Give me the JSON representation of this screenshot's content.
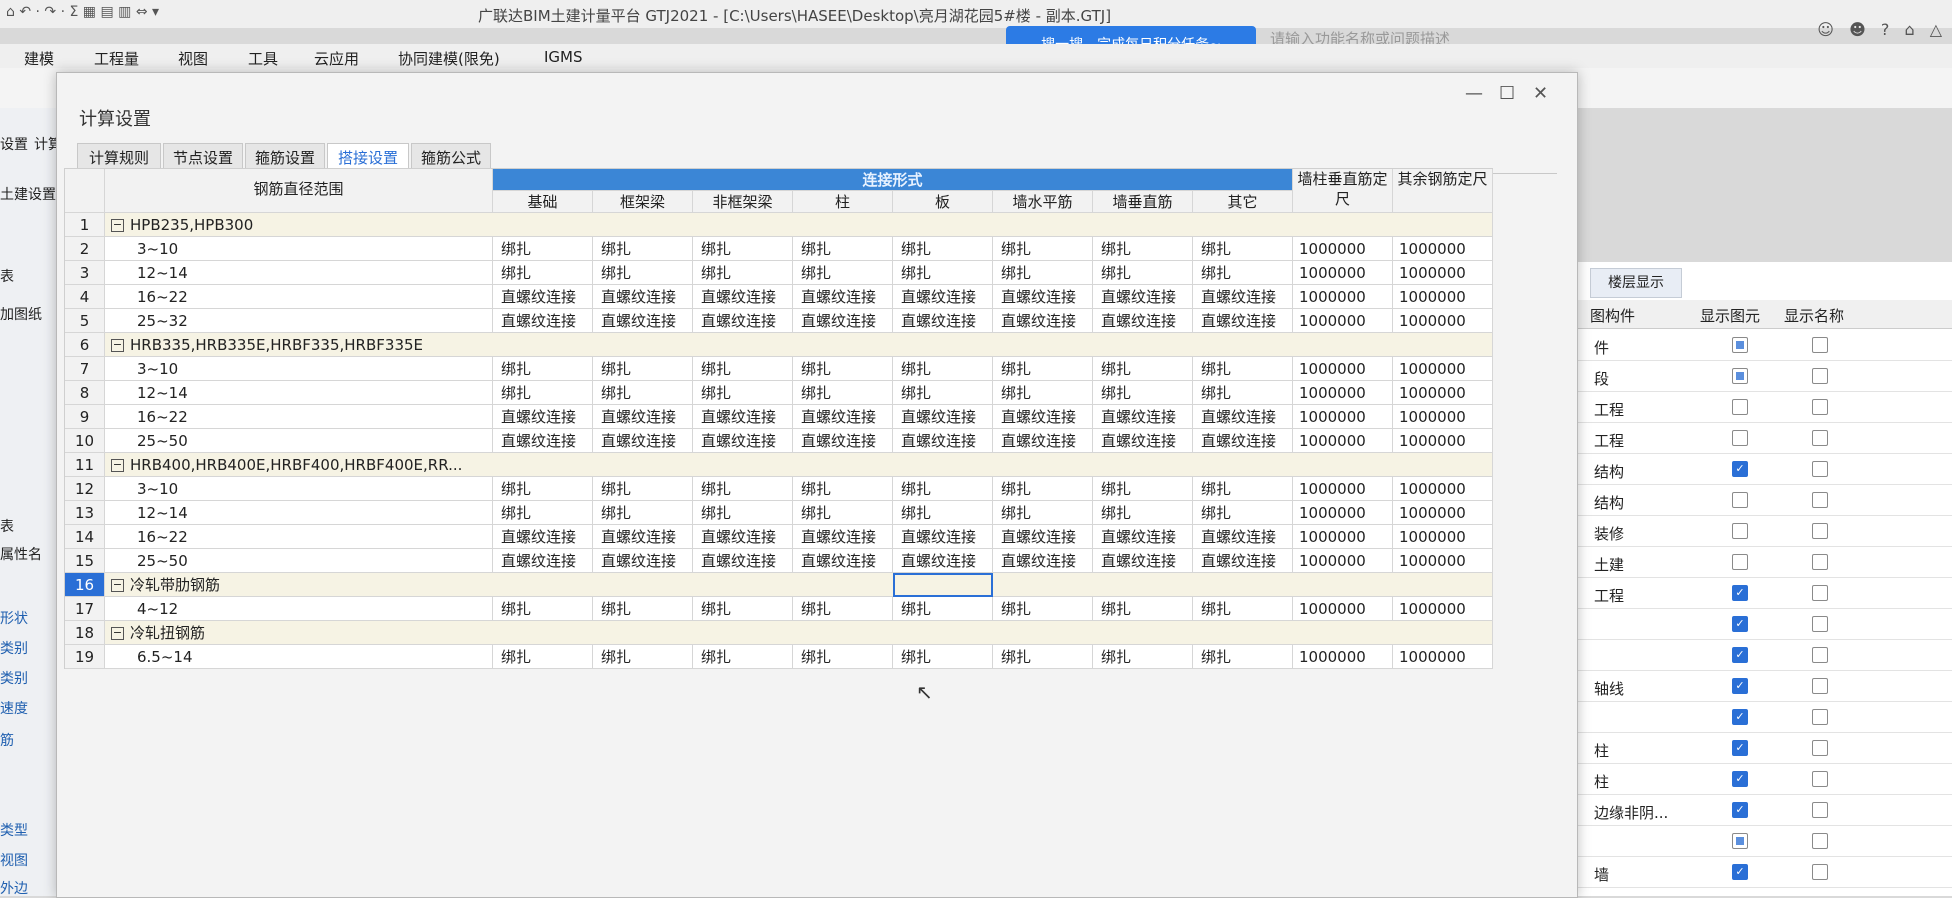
{
  "app": {
    "title": "广联达BIM土建计量平台 GTJ2021 - [C:\\Users\\HASEE\\Desktop\\亮月湖花园5#楼 - 副本.GTJ]",
    "tip": "搜一搜，完成每日积分任务~",
    "search_placeholder": "请输入功能名称或问题描述",
    "quick_access": "⌂ ↶ · ↷ · Σ ▦ ▤ ▥ ⇔ ▾",
    "window_controls": [
      "☺",
      "☻",
      "?",
      "⌂",
      "△"
    ]
  },
  "menu": [
    "建模",
    "工程量",
    "视图",
    "工具",
    "云应用",
    "协同建模(限免)",
    "IGMS"
  ],
  "left_strip": [
    "设置",
    "计算",
    "土建设置",
    "表",
    "加图纸",
    "表",
    "属性名",
    "形状",
    "类别",
    "类别",
    "速度",
    "筋",
    "类型",
    "视图",
    "外边"
  ],
  "right_panel": {
    "tab": "楼层显示",
    "headers": [
      "图构件",
      "显示图元",
      "显示名称"
    ],
    "rows": [
      {
        "name": "件",
        "shown": "partial",
        "name_shown": "off"
      },
      {
        "name": "段",
        "shown": "partial",
        "name_shown": "off"
      },
      {
        "name": "工程",
        "shown": "off",
        "name_shown": "off"
      },
      {
        "name": "工程",
        "shown": "off",
        "name_shown": "off"
      },
      {
        "name": "结构",
        "shown": "on",
        "name_shown": "off"
      },
      {
        "name": "结构",
        "shown": "off",
        "name_shown": "off"
      },
      {
        "name": "装修",
        "shown": "off",
        "name_shown": "off"
      },
      {
        "name": "土建",
        "shown": "off",
        "name_shown": "off"
      },
      {
        "name": "工程",
        "shown": "on",
        "name_shown": "off"
      },
      {
        "name": "",
        "shown": "on",
        "name_shown": "off"
      },
      {
        "name": "",
        "shown": "on",
        "name_shown": "off"
      },
      {
        "name": "轴线",
        "shown": "on",
        "name_shown": "off"
      },
      {
        "name": "",
        "shown": "on",
        "name_shown": "off"
      },
      {
        "name": "柱",
        "shown": "on",
        "name_shown": "off"
      },
      {
        "name": "柱",
        "shown": "on",
        "name_shown": "off"
      },
      {
        "name": "边缘非阴...",
        "shown": "on",
        "name_shown": "off"
      },
      {
        "name": "",
        "shown": "partial",
        "name_shown": "off"
      },
      {
        "name": "墙",
        "shown": "on",
        "name_shown": "off"
      }
    ]
  },
  "dialog": {
    "title": "计算设置",
    "controls": [
      "—",
      "☐",
      "✕"
    ],
    "tabs": [
      "计算规则",
      "节点设置",
      "箍筋设置",
      "搭接设置",
      "箍筋公式"
    ],
    "active_tab": 3,
    "grid": {
      "col_range": "钢筋直径范围",
      "group_header": "连接形式",
      "sub_headers": [
        "基础",
        "框架梁",
        "非框架梁",
        "柱",
        "板",
        "墙水平筋",
        "墙垂直筋",
        "其它"
      ],
      "col_wall": "墙柱垂直筋定尺",
      "col_other": "其余钢筋定尺",
      "rows": [
        {
          "n": "1",
          "label": "HPB235,HPB300",
          "group": true
        },
        {
          "n": "2",
          "label": "3~10",
          "vals": [
            "绑扎",
            "绑扎",
            "绑扎",
            "绑扎",
            "绑扎",
            "绑扎",
            "绑扎",
            "绑扎"
          ],
          "wall": "1000000",
          "other": "1000000"
        },
        {
          "n": "3",
          "label": "12~14",
          "vals": [
            "绑扎",
            "绑扎",
            "绑扎",
            "绑扎",
            "绑扎",
            "绑扎",
            "绑扎",
            "绑扎"
          ],
          "wall": "1000000",
          "other": "1000000"
        },
        {
          "n": "4",
          "label": "16~22",
          "vals": [
            "直螺纹连接",
            "直螺纹连接",
            "直螺纹连接",
            "直螺纹连接",
            "直螺纹连接",
            "直螺纹连接",
            "直螺纹连接",
            "直螺纹连接"
          ],
          "wall": "1000000",
          "other": "1000000"
        },
        {
          "n": "5",
          "label": "25~32",
          "vals": [
            "直螺纹连接",
            "直螺纹连接",
            "直螺纹连接",
            "直螺纹连接",
            "直螺纹连接",
            "直螺纹连接",
            "直螺纹连接",
            "直螺纹连接"
          ],
          "wall": "1000000",
          "other": "1000000"
        },
        {
          "n": "6",
          "label": "HRB335,HRB335E,HRBF335,HRBF335E",
          "group": true
        },
        {
          "n": "7",
          "label": "3~10",
          "vals": [
            "绑扎",
            "绑扎",
            "绑扎",
            "绑扎",
            "绑扎",
            "绑扎",
            "绑扎",
            "绑扎"
          ],
          "wall": "1000000",
          "other": "1000000"
        },
        {
          "n": "8",
          "label": "12~14",
          "vals": [
            "绑扎",
            "绑扎",
            "绑扎",
            "绑扎",
            "绑扎",
            "绑扎",
            "绑扎",
            "绑扎"
          ],
          "wall": "1000000",
          "other": "1000000"
        },
        {
          "n": "9",
          "label": "16~22",
          "vals": [
            "直螺纹连接",
            "直螺纹连接",
            "直螺纹连接",
            "直螺纹连接",
            "直螺纹连接",
            "直螺纹连接",
            "直螺纹连接",
            "直螺纹连接"
          ],
          "wall": "1000000",
          "other": "1000000"
        },
        {
          "n": "10",
          "label": "25~50",
          "vals": [
            "直螺纹连接",
            "直螺纹连接",
            "直螺纹连接",
            "直螺纹连接",
            "直螺纹连接",
            "直螺纹连接",
            "直螺纹连接",
            "直螺纹连接"
          ],
          "wall": "1000000",
          "other": "1000000"
        },
        {
          "n": "11",
          "label": "HRB400,HRB400E,HRBF400,HRBF400E,RR...",
          "group": true
        },
        {
          "n": "12",
          "label": "3~10",
          "vals": [
            "绑扎",
            "绑扎",
            "绑扎",
            "绑扎",
            "绑扎",
            "绑扎",
            "绑扎",
            "绑扎"
          ],
          "wall": "1000000",
          "other": "1000000"
        },
        {
          "n": "13",
          "label": "12~14",
          "vals": [
            "绑扎",
            "绑扎",
            "绑扎",
            "绑扎",
            "绑扎",
            "绑扎",
            "绑扎",
            "绑扎"
          ],
          "wall": "1000000",
          "other": "1000000"
        },
        {
          "n": "14",
          "label": "16~22",
          "vals": [
            "直螺纹连接",
            "直螺纹连接",
            "直螺纹连接",
            "直螺纹连接",
            "直螺纹连接",
            "直螺纹连接",
            "直螺纹连接",
            "直螺纹连接"
          ],
          "wall": "1000000",
          "other": "1000000"
        },
        {
          "n": "15",
          "label": "25~50",
          "vals": [
            "直螺纹连接",
            "直螺纹连接",
            "直螺纹连接",
            "直螺纹连接",
            "直螺纹连接",
            "直螺纹连接",
            "直螺纹连接",
            "直螺纹连接"
          ],
          "wall": "1000000",
          "other": "1000000"
        },
        {
          "n": "16",
          "label": "冷轧带肋钢筋",
          "group": true,
          "selected": true
        },
        {
          "n": "17",
          "label": "4~12",
          "vals": [
            "绑扎",
            "绑扎",
            "绑扎",
            "绑扎",
            "绑扎",
            "绑扎",
            "绑扎",
            "绑扎"
          ],
          "wall": "1000000",
          "other": "1000000"
        },
        {
          "n": "18",
          "label": "冷轧扭钢筋",
          "group": true
        },
        {
          "n": "19",
          "label": "6.5~14",
          "vals": [
            "绑扎",
            "绑扎",
            "绑扎",
            "绑扎",
            "绑扎",
            "绑扎",
            "绑扎",
            "绑扎"
          ],
          "wall": "1000000",
          "other": "1000000"
        }
      ]
    }
  }
}
